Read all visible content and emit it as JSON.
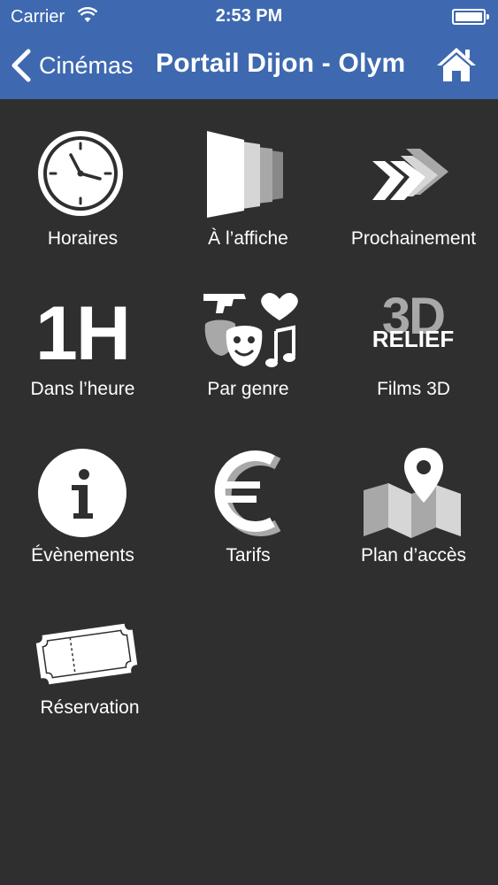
{
  "status_bar": {
    "carrier": "Carrier",
    "time": "2:53 PM"
  },
  "nav": {
    "back_label": "Cinémas",
    "title": "Portail Dijon - Olym"
  },
  "colors": {
    "header": "#3e69b0",
    "background": "#2f2f2f",
    "icon": "#ffffff",
    "icon_shade": "#a8a8a8"
  },
  "menu": [
    {
      "label": "Horaires",
      "icon": "clock-icon"
    },
    {
      "label": "À l’affiche",
      "icon": "posters-icon"
    },
    {
      "label": "Prochainement",
      "icon": "chevrons-icon"
    },
    {
      "label": "Dans l’heure",
      "icon": "one-hour-icon"
    },
    {
      "label": "Par genre",
      "icon": "genre-icon"
    },
    {
      "label": "Films 3D",
      "icon": "three-d-relief-icon"
    },
    {
      "label": "Évènements",
      "icon": "info-icon"
    },
    {
      "label": "Tarifs",
      "icon": "euro-icon"
    },
    {
      "label": "Plan d’accès",
      "icon": "map-pin-icon"
    },
    {
      "label": "Réservation",
      "icon": "ticket-icon"
    }
  ],
  "badges": {
    "one_hour": "1H",
    "three_d": "3D",
    "relief": "RELIEF"
  }
}
